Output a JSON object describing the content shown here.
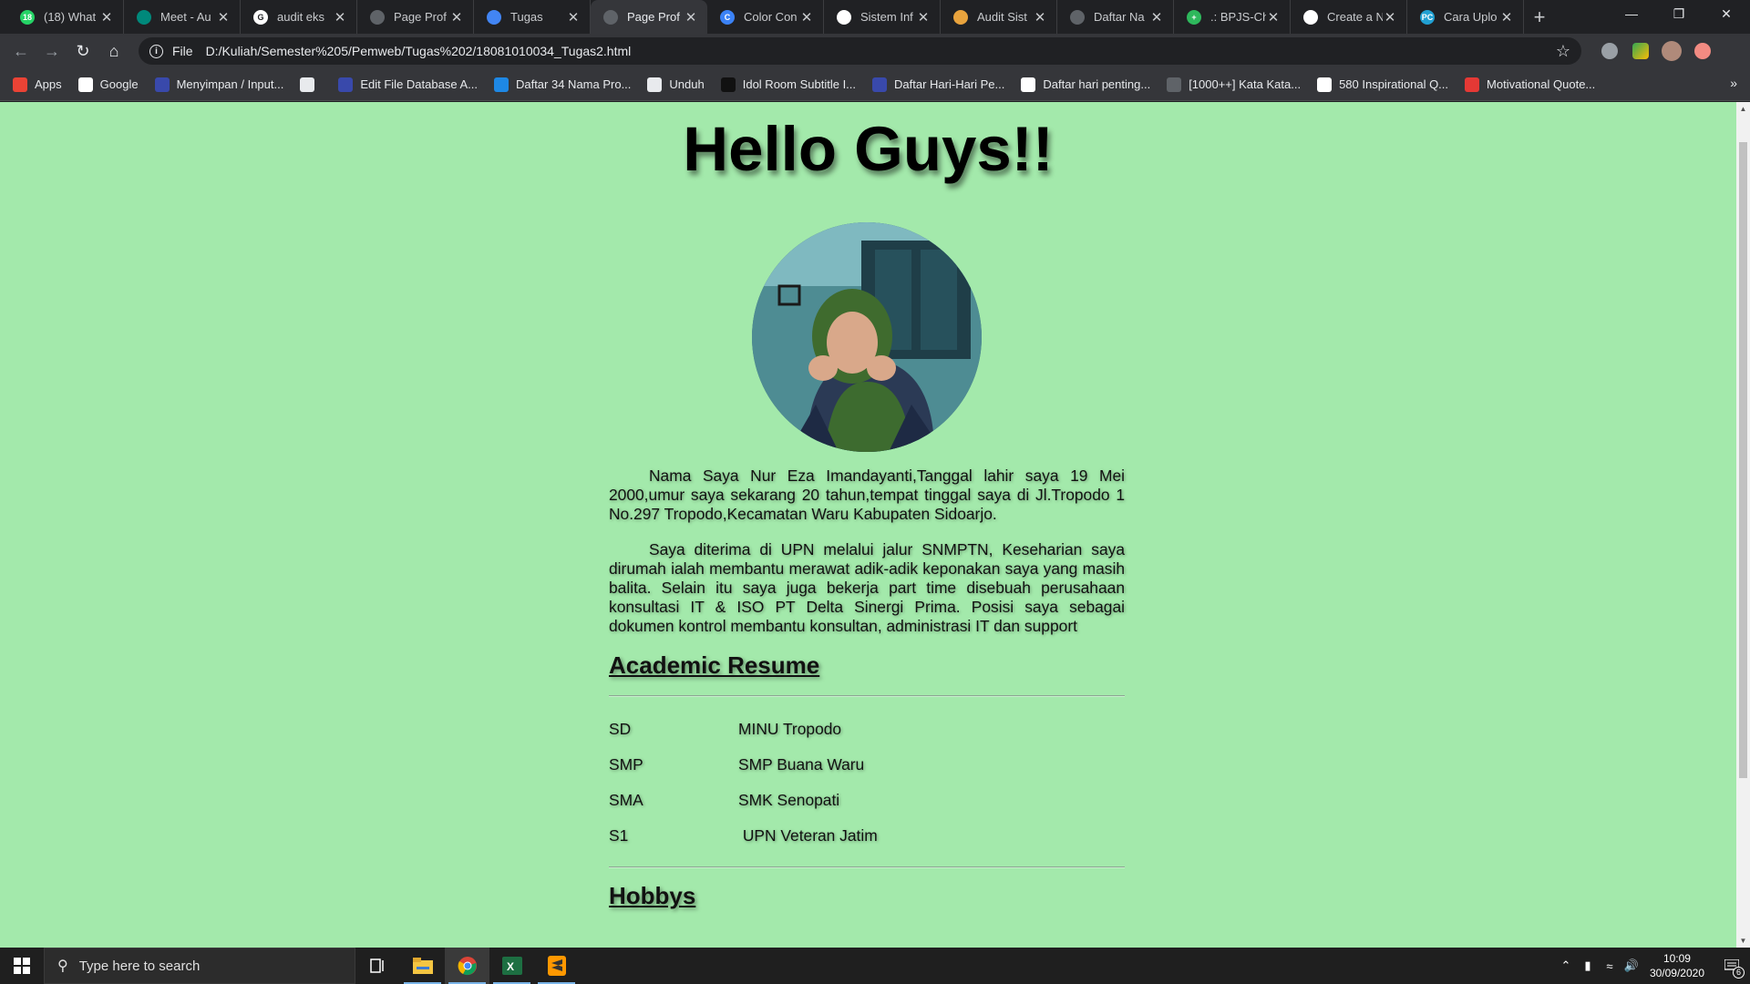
{
  "browser": {
    "tabs": [
      {
        "title": "(18) What",
        "favicon_color": "#25d366",
        "favicon_text": "18"
      },
      {
        "title": "Meet - Au",
        "favicon_color": "#00897b",
        "favicon_text": ""
      },
      {
        "title": "audit eks",
        "favicon_color": "#ffffff",
        "favicon_text": "G"
      },
      {
        "title": "Page Prof",
        "favicon_color": "#5f6368",
        "favicon_text": ""
      },
      {
        "title": "Tugas",
        "favicon_color": "#4285f4",
        "favicon_text": ""
      },
      {
        "title": "Page Prof",
        "favicon_color": "#5f6368",
        "favicon_text": "",
        "active": true
      },
      {
        "title": "Color Con",
        "favicon_color": "#3b82f6",
        "favicon_text": "C"
      },
      {
        "title": "Sistem Inf",
        "favicon_color": "#ffffff",
        "favicon_text": ""
      },
      {
        "title": "Audit Sist",
        "favicon_color": "#e8a33d",
        "favicon_text": ""
      },
      {
        "title": "Daftar Na",
        "favicon_color": "#5f6368",
        "favicon_text": ""
      },
      {
        "title": ".: BPJS-Ch",
        "favicon_color": "#2eb85c",
        "favicon_text": "+"
      },
      {
        "title": "Create a N",
        "favicon_color": "#ffffff",
        "favicon_text": ""
      },
      {
        "title": "Cara Uplo",
        "favicon_color": "#21a0d2",
        "favicon_text": "PC"
      }
    ],
    "new_tab": "+",
    "address_scheme": "File",
    "address_url": "D:/Kuliah/Semester%205/Pemweb/Tugas%202/18081010034_Tugas2.html",
    "bookmarks": [
      {
        "label": "Apps",
        "color": "#ea4335"
      },
      {
        "label": "Google",
        "color": "#ffffff"
      },
      {
        "label": "Menyimpan / Input...",
        "color": "#3949ab"
      },
      {
        "label": "",
        "color": "#e8eaed"
      },
      {
        "label": "Edit File Database A...",
        "color": "#3949ab"
      },
      {
        "label": "Daftar 34 Nama Pro...",
        "color": "#1e88e5"
      },
      {
        "label": "Unduh",
        "color": "#e8eaed"
      },
      {
        "label": "Idol Room Subtitle I...",
        "color": "#111111"
      },
      {
        "label": "Daftar Hari-Hari Pe...",
        "color": "#3949ab"
      },
      {
        "label": "Daftar hari penting...",
        "color": "#ffffff"
      },
      {
        "label": "[1000++] Kata Kata...",
        "color": "#5f6368"
      },
      {
        "label": "580 Inspirational Q...",
        "color": "#ffffff"
      },
      {
        "label": "Motivational Quote...",
        "color": "#e53935"
      }
    ],
    "bookmarks_more": "»"
  },
  "page": {
    "title": "Hello Guys!!",
    "paragraphs": [
      "Nama Saya Nur Eza Imandayanti,Tanggal lahir saya 19 Mei 2000,umur saya sekarang 20 tahun,tempat tinggal saya di Jl.Tropodo 1 No.297 Tropodo,Kecamatan Waru Kabupaten Sidoarjo.",
      "Saya diterima di UPN melalui jalur SNMPTN, Keseharian saya dirumah ialah membantu merawat adik-adik keponakan saya yang masih balita. Selain itu saya juga bekerja part time disebuah perusahaan konsultasi IT & ISO PT Delta Sinergi Prima. Posisi saya sebagai dokumen kontrol membantu konsultan, administrasi IT dan support"
    ],
    "academic_heading": "Academic Resume",
    "education": [
      {
        "level": "SD",
        "school": "MINU Tropodo"
      },
      {
        "level": "SMP",
        "school": "SMP Buana Waru"
      },
      {
        "level": "SMA",
        "school": "SMK Senopati"
      },
      {
        "level": "S1",
        "school": " UPN Veteran Jatim"
      }
    ],
    "hobbys_heading": "Hobbys",
    "background_color": "#a3e9ab"
  },
  "taskbar": {
    "search_placeholder": "Type here to search",
    "time": "10:09",
    "date": "30/09/2020",
    "notification_count": "6"
  }
}
